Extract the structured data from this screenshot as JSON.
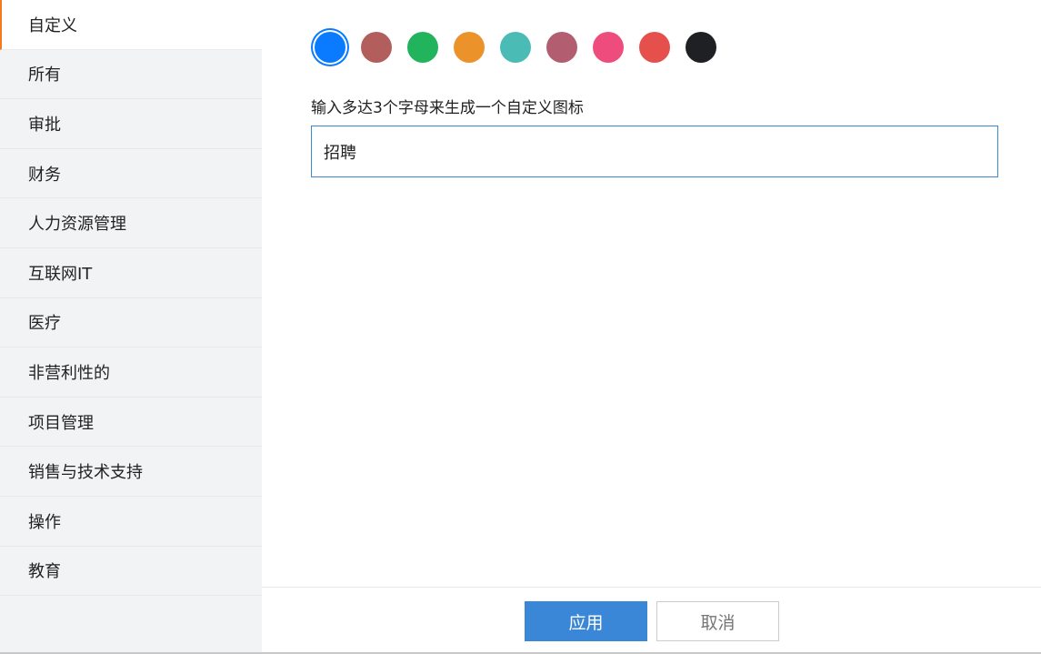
{
  "sidebar": {
    "items": [
      "自定义",
      "所有",
      "审批",
      "财务",
      "人力资源管理",
      "互联网IT",
      "医疗",
      "非营利性的",
      "项目管理",
      "销售与技术支持",
      "操作",
      "教育"
    ],
    "active": 0
  },
  "colors": [
    "#0a7bff",
    "#b15e5c",
    "#22b45c",
    "#eb922b",
    "#4abcb5",
    "#b35d71",
    "#ef4c7e",
    "#e5504c",
    "#1f2024"
  ],
  "selected_color": 0,
  "form": {
    "label": "输入多达3个字母来生成一个自定义图标",
    "value": "招聘"
  },
  "footer": {
    "apply": "应用",
    "cancel": "取消"
  }
}
